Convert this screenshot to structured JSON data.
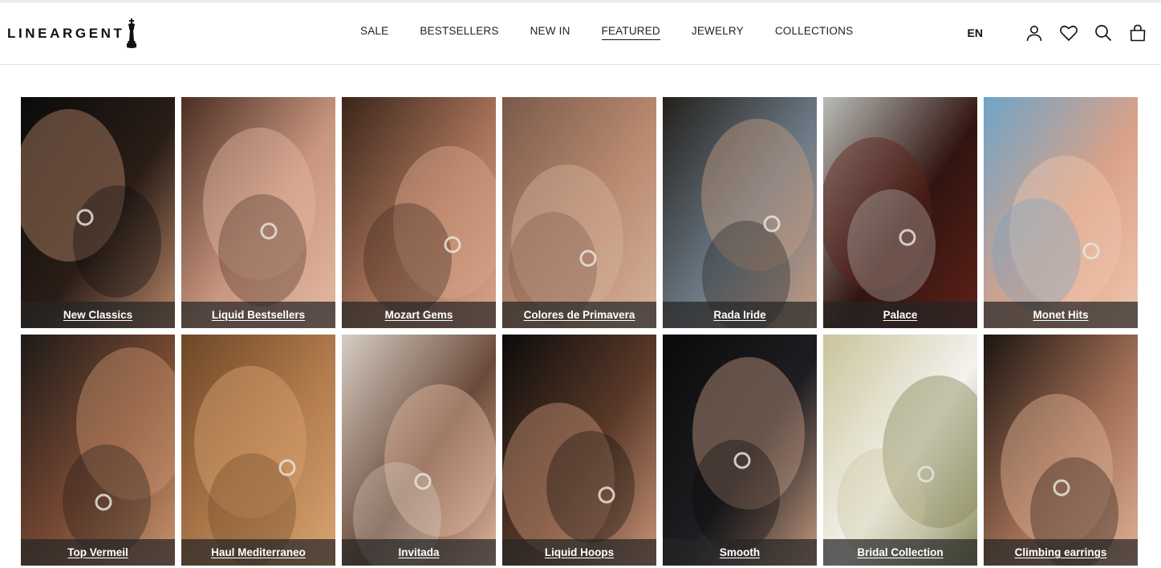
{
  "brand": {
    "name": "LINEARGENT"
  },
  "nav": [
    {
      "label": "SALE"
    },
    {
      "label": "BESTSELLERS"
    },
    {
      "label": "NEW IN"
    },
    {
      "label": "FEATURED",
      "active": true
    },
    {
      "label": "JEWELRY"
    },
    {
      "label": "COLLECTIONS"
    }
  ],
  "header": {
    "language": "EN",
    "icons": [
      "account-icon",
      "wishlist-heart-icon",
      "search-icon",
      "cart-bag-icon"
    ]
  },
  "collections": [
    {
      "label": "New Classics",
      "colors": [
        "#0b0b0b",
        "#2a1d16",
        "#b9876a"
      ]
    },
    {
      "label": "Liquid Bestsellers",
      "colors": [
        "#4a2e22",
        "#c99680",
        "#e4b9a2"
      ]
    },
    {
      "label": "Mozart Gems",
      "colors": [
        "#3a2519",
        "#a8735a",
        "#d9a78c"
      ]
    },
    {
      "label": "Colores de Primavera",
      "colors": [
        "#7a5a4a",
        "#b98a70",
        "#d7b29b"
      ]
    },
    {
      "label": "Rada Iride",
      "colors": [
        "#23201c",
        "#6c7a86",
        "#c69b80"
      ]
    },
    {
      "label": "Palace",
      "colors": [
        "#b9bcb7",
        "#311410",
        "#5e2118"
      ]
    },
    {
      "label": "Monet Hits",
      "colors": [
        "#6fa4c8",
        "#d9a288",
        "#f0c6ad"
      ]
    },
    {
      "label": "Top Vermeil",
      "colors": [
        "#1d1a18",
        "#7a4a34",
        "#c9946f"
      ]
    },
    {
      "label": "Haul Mediterraneo",
      "colors": [
        "#6e4726",
        "#b27c4e",
        "#d9a574"
      ]
    },
    {
      "label": "Invitada",
      "colors": [
        "#d8cec4",
        "#6a4a3a",
        "#e3b9a0"
      ]
    },
    {
      "label": "Liquid Hoops",
      "colors": [
        "#0c0b0a",
        "#5b3a2a",
        "#c99478"
      ]
    },
    {
      "label": "Smooth",
      "colors": [
        "#0a0a0a",
        "#1e1e22",
        "#c49a80"
      ]
    },
    {
      "label": "Bridal Collection",
      "colors": [
        "#c9c49a",
        "#f4f2ee",
        "#8a8a5a"
      ]
    },
    {
      "label": "Climbing earrings",
      "colors": [
        "#1c1410",
        "#a06e55",
        "#e0b195"
      ]
    }
  ]
}
